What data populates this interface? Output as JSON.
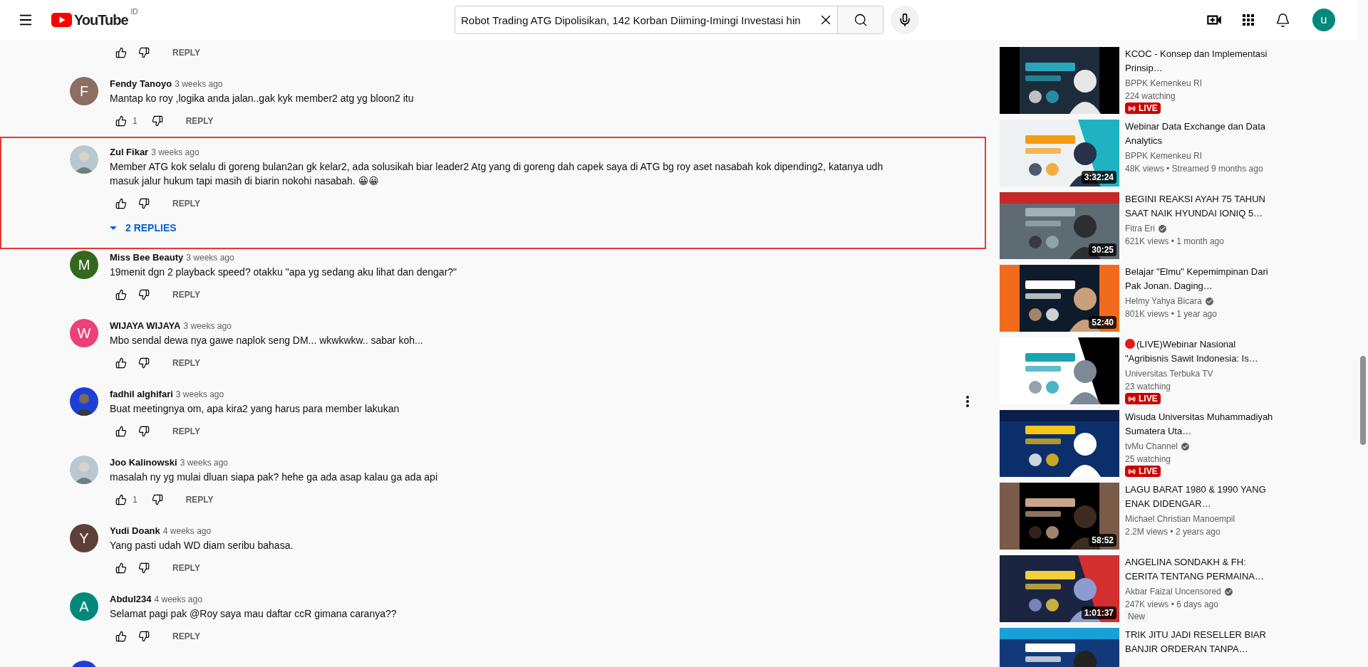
{
  "header": {
    "logo": "YouTube",
    "country": "ID",
    "search": {
      "value": "Robot Trading ATG Dipolisikan, 142 Korban Diiming-Imingi Investasi hin"
    },
    "avatar": "u"
  },
  "comments": {
    "partial_top": {
      "reply": "REPLY"
    },
    "items": [
      {
        "author": "Fendy Tanoyo",
        "time": "3 weeks ago",
        "text": "Mantap ko roy ,logika anda jalan..gak kyk member2 atg yg bloon2 itu",
        "avatar": {
          "kind": "letter",
          "letter": "F",
          "color": "#8d6e63"
        },
        "likes": "1",
        "reply": "REPLY",
        "highlighted": false,
        "menu": false
      },
      {
        "author": "Zul Fikar",
        "time": "3 weeks ago",
        "text": "Member ATG kok selalu di goreng bulan2an gk kelar2, ada solusikah biar leader2 Atg yang di goreng dah capek saya di ATG bg roy aset nasabah kok dipending2, katanya udh masuk jalur hukum tapi masih di biarin nokohi nasabah. 😀😀",
        "reply": "REPLY",
        "replies": "2 REPLIES",
        "highlighted": true,
        "menu": false
      },
      {
        "author": "Miss Bee Beauty",
        "time": "3 weeks ago",
        "text": "19menit dgn 2 playback speed? otakku \"apa yg sedang aku lihat dan dengar?\"",
        "avatar": {
          "kind": "letter",
          "letter": "M",
          "color": "#33691e"
        },
        "reply": "REPLY",
        "highlighted": false,
        "menu": false
      },
      {
        "author": "WIJAYA WIJAYA",
        "time": "3 weeks ago",
        "text": "Mbo sendal dewa nya gawe naplok seng DM... wkwkwkw.. sabar koh...",
        "avatar": {
          "kind": "letter",
          "letter": "W",
          "color": "#ec407a"
        },
        "reply": "REPLY",
        "highlighted": false,
        "menu": false
      },
      {
        "author": "fadhil alghifari",
        "time": "3 weeks ago",
        "text": "Buat meetingnya om, apa kira2 yang harus para member lakukan",
        "reply": "REPLY",
        "highlighted": false,
        "menu": true
      },
      {
        "author": "Joo Kalinowski",
        "time": "3 weeks ago",
        "text": "masalah ny yg mulai dluan siapa pak? hehe ga ada asap kalau ga ada api",
        "likes": "1",
        "reply": "REPLY",
        "highlighted": false,
        "menu": false
      },
      {
        "author": "Yudi Doank",
        "time": "4 weeks ago",
        "text": "Yang pasti udah WD diam seribu bahasa.",
        "avatar": {
          "kind": "letter",
          "letter": "Y",
          "color": "#5d4037"
        },
        "reply": "REPLY",
        "highlighted": false,
        "menu": false
      },
      {
        "author": "Abdul234",
        "time": "4 weeks ago",
        "text": "Selamat pagi pak @Roy saya mau daftar ccR gimana caranya??",
        "avatar": {
          "kind": "letter",
          "letter": "A",
          "color": "#00897b"
        },
        "reply": "REPLY",
        "highlighted": false,
        "menu": false
      },
      {
        "highlighted": false,
        "menu": false
      }
    ]
  },
  "sidebar": {
    "videos": [
      {
        "title": "KCOC - Konsep dan Implementasi Prinsip…",
        "channel": "BPPK Kemenkeu RI",
        "verified": false,
        "meta": "224 watching",
        "badge": {
          "kind": "live",
          "label": "LIVE"
        }
      },
      {
        "title": "Webinar Data Exchange dan Data Analytics",
        "channel": "BPPK Kemenkeu RI",
        "verified": false,
        "meta": "48K views • Streamed 9 months ago",
        "duration": "3:32:24"
      },
      {
        "title": "BEGINI REAKSI AYAH 75 TAHUN SAAT NAIK HYUNDAI IONIQ 5…",
        "channel": "Fitra Eri",
        "verified": true,
        "meta": "621K views • 1 month ago",
        "duration": "30:25"
      },
      {
        "title": "Belajar \"Elmu\" Kepemimpinan Dari Pak Jonan. Daging…",
        "channel": "Helmy Yahya Bicara",
        "verified": true,
        "meta": "801K views • 1 year ago",
        "duration": "52:40"
      },
      {
        "title": "(LIVE)Webinar Nasional \"Agribisnis Sawit Indonesia: Is…",
        "live_dot": true,
        "channel": "Universitas Terbuka TV",
        "verified": false,
        "meta": "23 watching",
        "badge": {
          "kind": "live",
          "label": "LIVE"
        }
      },
      {
        "title": "Wisuda Universitas Muhammadiyah Sumatera Uta…",
        "channel": "tvMu Channel",
        "verified": true,
        "meta": "25 watching",
        "badge": {
          "kind": "live",
          "label": "LIVE"
        }
      },
      {
        "title": "LAGU BARAT 1980 & 1990 YANG ENAK DIDENGAR…",
        "channel": "Michael Christian Manoempil",
        "verified": false,
        "meta": "2.2M views • 2 years ago",
        "duration": "58:52"
      },
      {
        "title": "ANGELINA SONDAKH & FH: CERITA TENTANG PERMAINA…",
        "channel": "Akbar Faizal Uncensored",
        "verified": true,
        "meta": "247K views • 6 days ago",
        "duration": "1:01:37",
        "badge": {
          "kind": "new",
          "label": "New"
        }
      },
      {
        "title": "TRIK JITU JADI RESELLER BIAR BANJIR ORDERAN TANPA…"
      }
    ]
  }
}
